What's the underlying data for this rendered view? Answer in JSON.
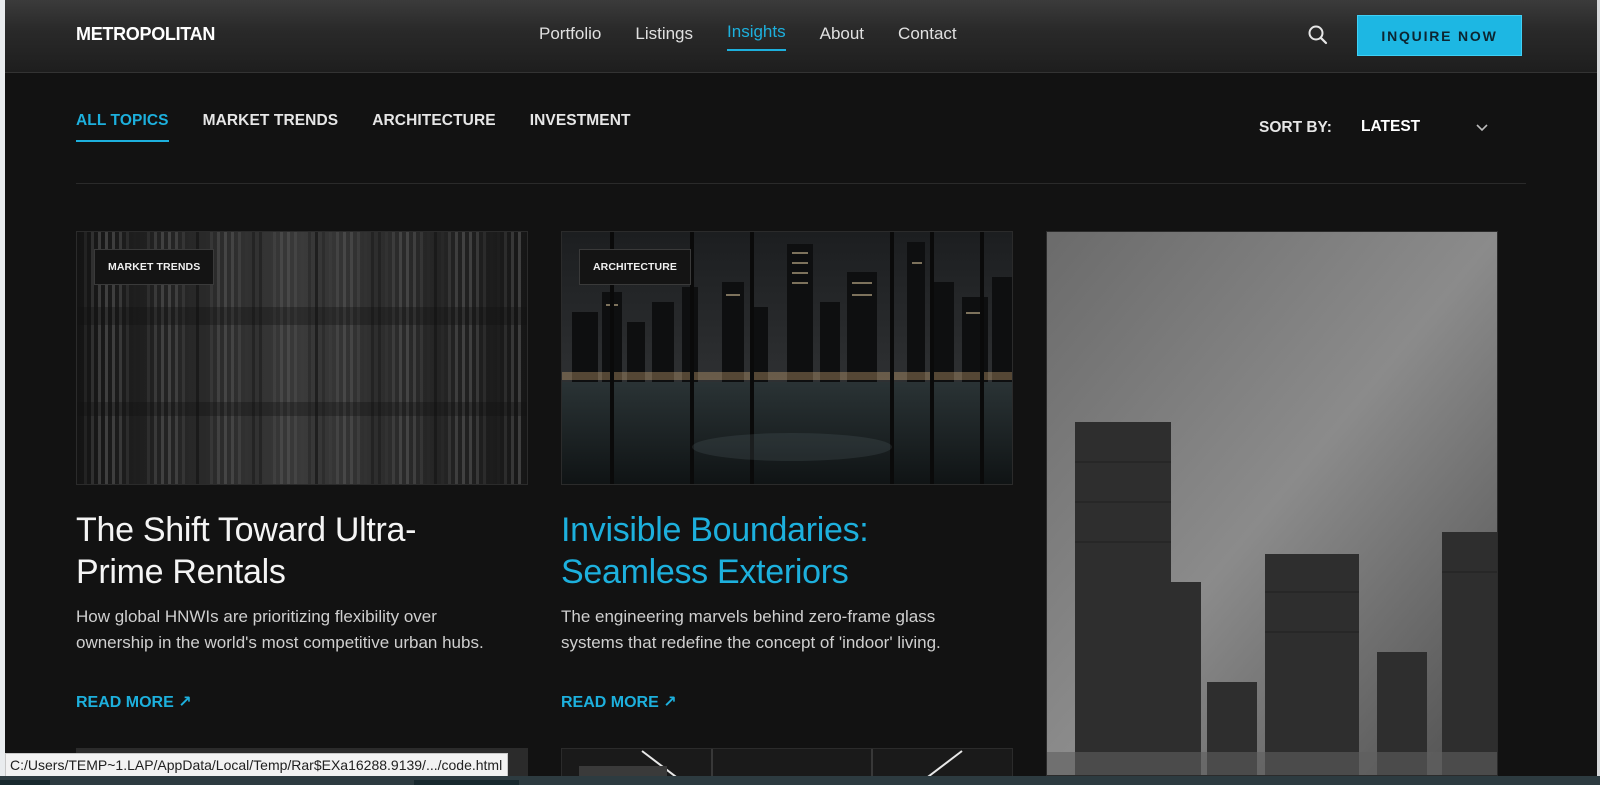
{
  "header": {
    "logo": "METROPOLITAN",
    "nav": [
      {
        "label": "Portfolio",
        "active": false
      },
      {
        "label": "Listings",
        "active": false
      },
      {
        "label": "Insights",
        "active": true
      },
      {
        "label": "About",
        "active": false
      },
      {
        "label": "Contact",
        "active": false
      }
    ],
    "search_icon": "search-icon",
    "cta_label": "INQUIRE NOW"
  },
  "filters": {
    "tabs": [
      {
        "label": "ALL TOPICS",
        "active": true
      },
      {
        "label": "MARKET TRENDS",
        "active": false
      },
      {
        "label": "ARCHITECTURE",
        "active": false
      },
      {
        "label": "INVESTMENT",
        "active": false
      }
    ],
    "sort_label": "SORT BY:",
    "sort_value": "LATEST",
    "sort_icon": "chevron-down-icon"
  },
  "articles": [
    {
      "badge": "MARKET TRENDS",
      "title_line1": "The Shift Toward Ultra-",
      "title_line2": "Prime Rentals",
      "desc_line1": "How global HNWIs are prioritizing flexibility over",
      "desc_line2": "ownership in the world's most competitive urban hubs.",
      "read_more": "READ MORE ↗"
    },
    {
      "badge": "ARCHITECTURE",
      "title_line1": "Invisible Boundaries:",
      "title_line2": "Seamless Exteriors",
      "desc_line1": "The engineering marvels behind zero-frame glass",
      "desc_line2": "systems that redefine the concept of 'indoor' living.",
      "read_more": "READ MORE ↗"
    }
  ],
  "colors": {
    "accent": "#1db0dd",
    "background": "#121212",
    "cta": "#1db7e3"
  },
  "status_bar": "C:/Users/TEMP~1.LAP/AppData/Local/Temp/Rar$EXa16288.9139/.../code.html"
}
